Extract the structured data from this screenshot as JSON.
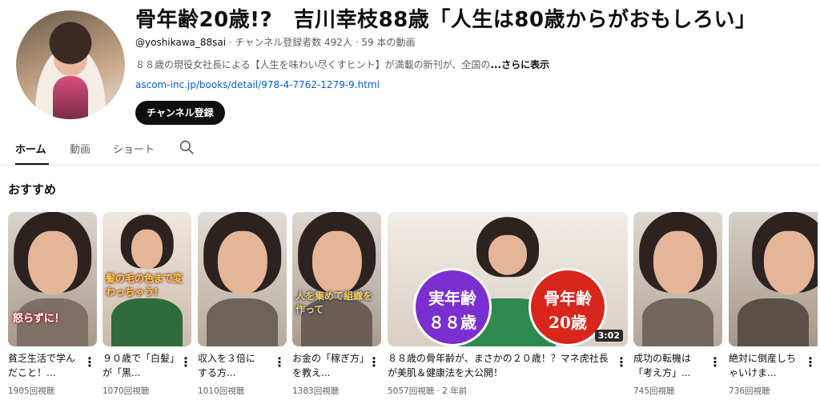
{
  "channel": {
    "title": "骨年齢20歳!?　吉川幸枝88歳「人生は80歳からがおもしろい」",
    "handle": "@yoshikawa_88sai",
    "stats": " · チャンネル登録者数 492人 · 59 本の動画",
    "description": "８８歳の現役女社長による【人生を味わい尽くすヒント】が満載の新刊が、全国の",
    "more_label": "...さらに表示",
    "link": "ascom-inc.jp/books/detail/978-4-7762-1279-9.html",
    "subscribe_label": "チャンネル登録"
  },
  "tabs": [
    {
      "label": "ホーム"
    },
    {
      "label": "動画"
    },
    {
      "label": "ショート"
    }
  ],
  "section_title": "おすすめ",
  "videos": [
    {
      "title": "貧乏生活で学んだこと！...",
      "views": "1905回視聴",
      "caption": "怒らずに！"
    },
    {
      "title": "９０歳で「白髪」が「黒...",
      "views": "1070回視聴",
      "caption": "髪の毛の色まで変わっちゃう!"
    },
    {
      "title": "収入を３倍にする方...",
      "views": "1010回視聴",
      "caption": ""
    },
    {
      "title": "お金の「稼ぎ方」を教え...",
      "views": "1383回視聴",
      "caption": "人を集めて組織を作って"
    },
    {
      "title": "８８歳の骨年齢が、まさかの２０歳！？マネ虎社長が美肌＆健康法を大公開！",
      "views": "5057回視聴 · 2 年前",
      "badge_left": "実年齢\n８８歳",
      "badge_right": "骨年齢\n20歳",
      "duration": "3:02"
    },
    {
      "title": "成功の転機は「考え方」...",
      "views": "745回視聴",
      "caption": ""
    },
    {
      "title": "絶対に倒産しちゃいけま...",
      "views": "736回視聴",
      "caption": ""
    }
  ],
  "icons": {
    "search": "search-icon",
    "more": "more-vert-icon"
  },
  "colors": {
    "accent": "#0f0f0f",
    "link": "#065fd4",
    "badge_purple": "#7b2fd0",
    "badge_red": "#d9261c"
  }
}
